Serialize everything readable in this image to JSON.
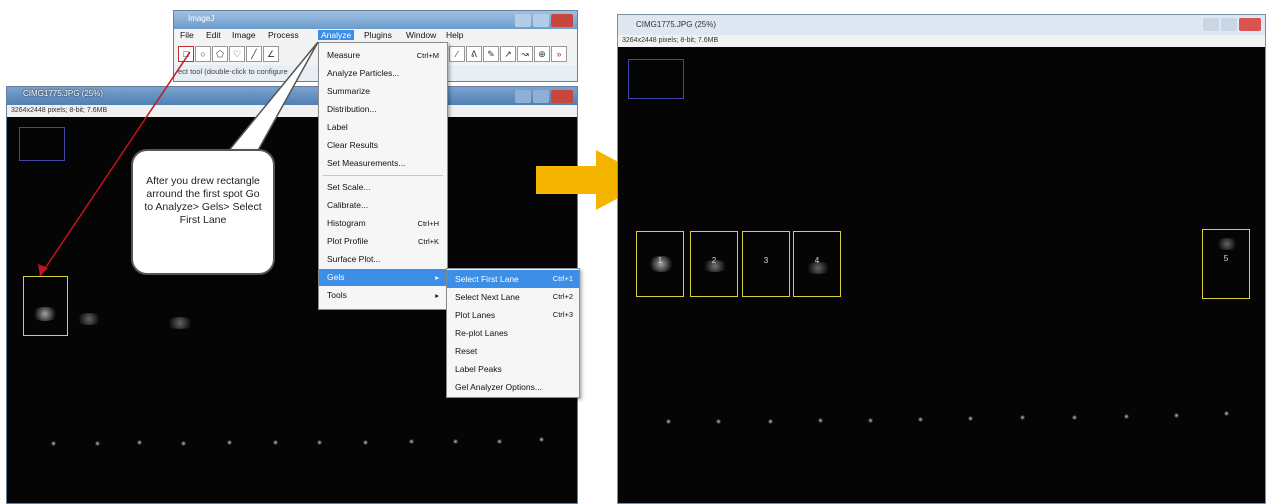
{
  "imagej": {
    "title": "ImageJ",
    "menu": [
      "File",
      "Edit",
      "Image",
      "Process",
      "Analyze",
      "Plugins",
      "Window",
      "Help"
    ],
    "status": "ect tool (double-click to configure"
  },
  "left_window": {
    "title": "CIMG1775.JPG (25%)",
    "info": "3264x2448 pixels; 8-bit; 7.6MB"
  },
  "analyze_menu": [
    {
      "label": "Measure",
      "shortcut": "Ctrl+M"
    },
    {
      "label": "Analyze Particles...",
      "shortcut": ""
    },
    {
      "label": "Summarize",
      "shortcut": ""
    },
    {
      "label": "Distribution...",
      "shortcut": ""
    },
    {
      "label": "Label",
      "shortcut": ""
    },
    {
      "label": "Clear Results",
      "shortcut": ""
    },
    {
      "label": "Set Measurements...",
      "shortcut": ""
    },
    {
      "label": "Set Scale...",
      "shortcut": ""
    },
    {
      "label": "Calibrate...",
      "shortcut": ""
    },
    {
      "label": "Histogram",
      "shortcut": "Ctrl+H"
    },
    {
      "label": "Plot Profile",
      "shortcut": "Ctrl+K"
    },
    {
      "label": "Surface Plot...",
      "shortcut": ""
    },
    {
      "label": "Gels",
      "shortcut": "▸"
    },
    {
      "label": "Tools",
      "shortcut": "▸"
    }
  ],
  "gels_submenu": [
    {
      "label": "Select First Lane",
      "shortcut": "Ctrl+1"
    },
    {
      "label": "Select Next Lane",
      "shortcut": "Ctrl+2"
    },
    {
      "label": "Plot Lanes",
      "shortcut": "Ctrl+3"
    },
    {
      "label": "Re-plot Lanes",
      "shortcut": ""
    },
    {
      "label": "Reset",
      "shortcut": ""
    },
    {
      "label": "Label Peaks",
      "shortcut": ""
    },
    {
      "label": "Gel Analyzer Options...",
      "shortcut": ""
    }
  ],
  "callout": {
    "text": "After you drew rectangle arround the first spot Go to Analyze> Gels> Select First Lane"
  },
  "right_window": {
    "title": "CIMG1775.JPG (25%)",
    "info": "3264x2448 pixels; 8-bit; 7.6MB",
    "lanes": [
      "1",
      "2",
      "3",
      "4",
      "5"
    ]
  },
  "colors": {
    "arrow": "#f4b400",
    "highlight": "#3d8ee6",
    "lane_box": "#d8cf3a",
    "red_arrow": "#c0161c"
  }
}
